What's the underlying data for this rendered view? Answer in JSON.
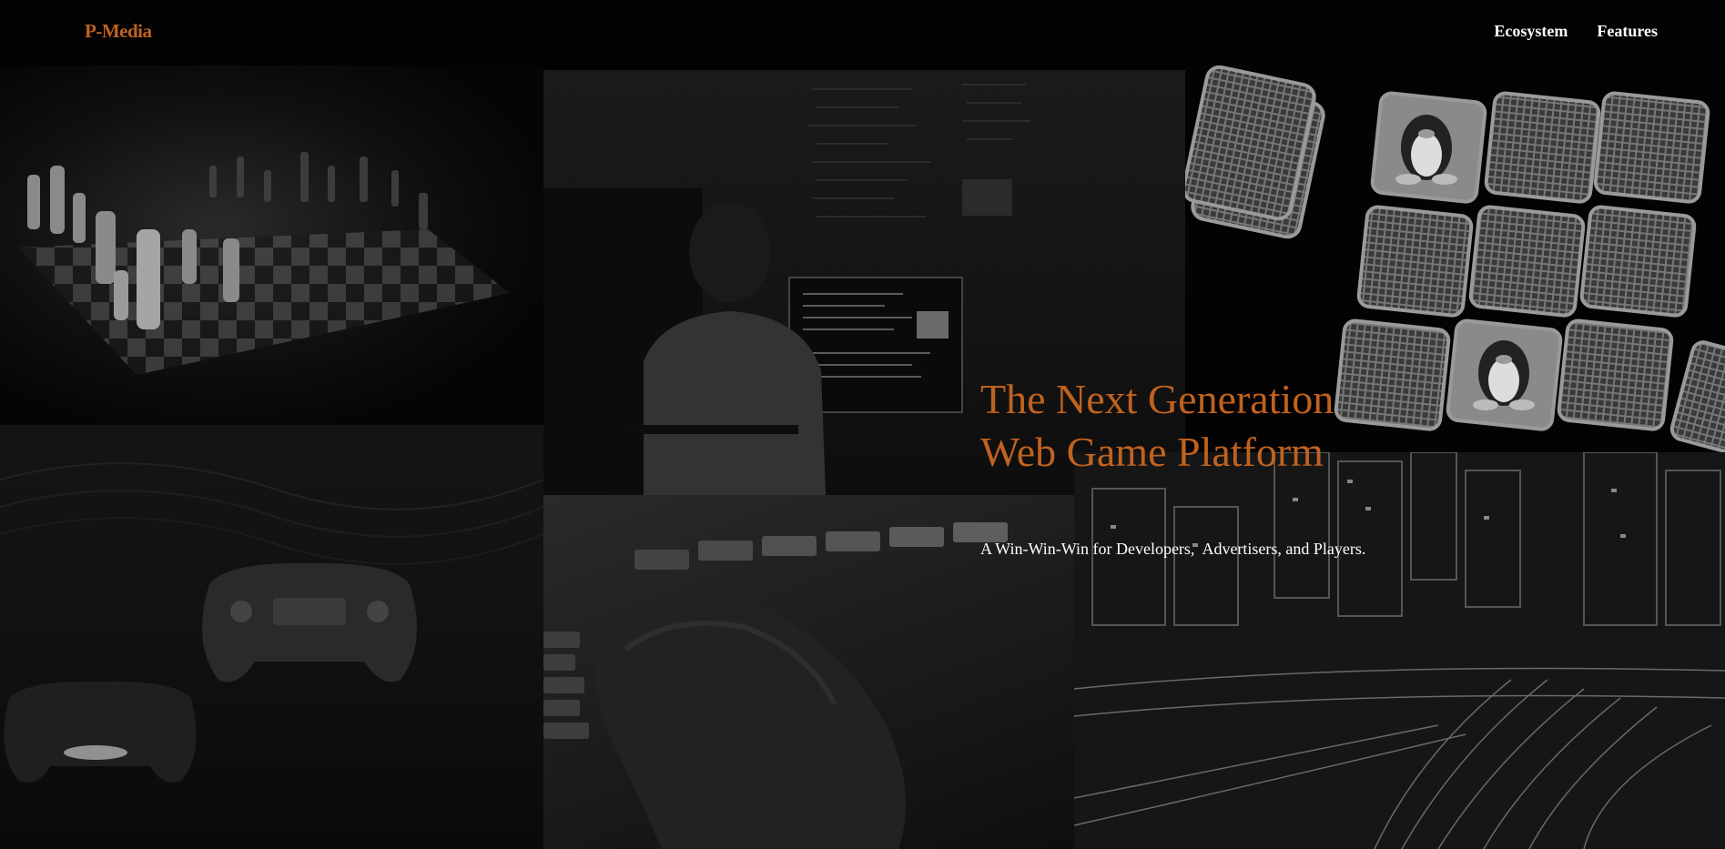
{
  "header": {
    "logo": "P-Media",
    "nav": [
      {
        "label": "Ecosystem"
      },
      {
        "label": "Features"
      }
    ]
  },
  "hero": {
    "title_line1": "The Next Generation",
    "title_line2": "Web Game Platform",
    "subtitle": "A Win-Win-Win for Developers,  Advertisers, and Players."
  },
  "colors": {
    "background": "#000000",
    "accent": "#c0621f",
    "text": "#ffffff"
  },
  "background_images": [
    {
      "name": "chess-board-image"
    },
    {
      "name": "developer-at-computer-image"
    },
    {
      "name": "memory-cards-penguin-image"
    },
    {
      "name": "game-controller-image"
    },
    {
      "name": "keyboard-hand-image"
    },
    {
      "name": "city-night-lines-image"
    }
  ]
}
